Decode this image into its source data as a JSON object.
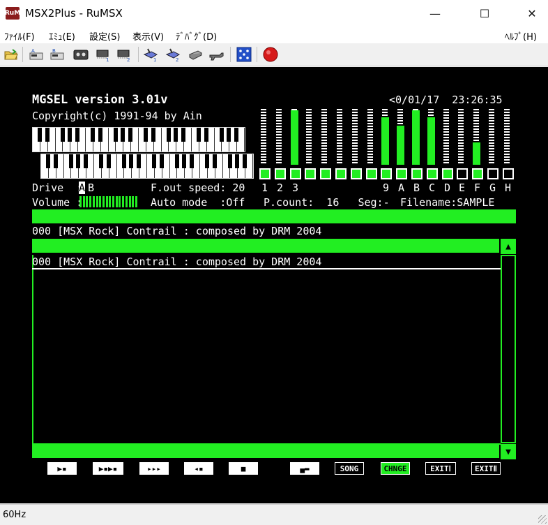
{
  "window": {
    "title": "MSX2Plus - RuMSX",
    "icon_label": "RuM",
    "minimize": "—",
    "maximize": "☐",
    "close": "✕"
  },
  "menu": {
    "items": [
      "ﾌｧｲﾙ(F)",
      "ｴﾐｭ(E)",
      "設定(S)",
      "表示(V)",
      "ﾃﾞﾊﾞｸﾞ(D)"
    ],
    "help": "ﾍﾙﾌﾟ(H)"
  },
  "toolbar": {
    "icons": [
      "open-folder-icon",
      "disk-a-icon",
      "disk-b-icon",
      "cassette-icon",
      "cartridge-1-icon",
      "cartridge-2-icon",
      "joystick-1-icon",
      "joystick-2-icon",
      "printer-icon",
      "gun-icon",
      "dice-icon",
      "record-icon"
    ]
  },
  "msx": {
    "title": "MGSEL version 3.01v",
    "copyright": "Copyright(c) 1991-94 by Ain",
    "datetime": "<0/01/17  23:26:35",
    "drive_label": "Drive  :",
    "drive_a": "A",
    "drive_b": "B",
    "volume_label": "Volume :",
    "fout_label": "F.out speed: 20",
    "auto_label": "Auto mode  :Off",
    "channels": [
      "1",
      "2",
      "3",
      "",
      "",
      "",
      "",
      "",
      "9",
      "A",
      "B",
      "C",
      "D",
      "E",
      "F",
      "G",
      "H"
    ],
    "channel_levels": [
      0.0,
      0.0,
      0.98,
      0.0,
      0.0,
      0.0,
      0.0,
      0.0,
      0.85,
      0.7,
      0.98,
      0.85,
      0.0,
      0.0,
      0.4,
      0.0,
      0.0
    ],
    "channel_active": [
      true,
      true,
      true,
      true,
      true,
      true,
      true,
      true,
      true,
      true,
      true,
      true,
      true,
      false,
      true,
      false,
      false
    ],
    "pcount": "P.count:  16   Seg:-",
    "filename": "Filename:SAMPLE",
    "playing": "000 [MSX Rock] Contrail : composed by DRM 2004",
    "list": [
      "000 [MSX Rock] Contrail : composed by DRM 2004"
    ],
    "scroll_up": "▲",
    "scroll_down": "▼",
    "buttons": [
      "▶▪",
      "▶▪▶▪",
      "▸▸▸",
      "◂▪",
      "■",
      "▄▬",
      "SONG",
      "CHNGE",
      "EXITⅠ",
      "EXITⅡ"
    ]
  },
  "status": {
    "text": "60Hz"
  },
  "colors": {
    "msx_green": "#22ee22",
    "msx_bg": "#000000",
    "chrome": "#f0f0f0"
  }
}
